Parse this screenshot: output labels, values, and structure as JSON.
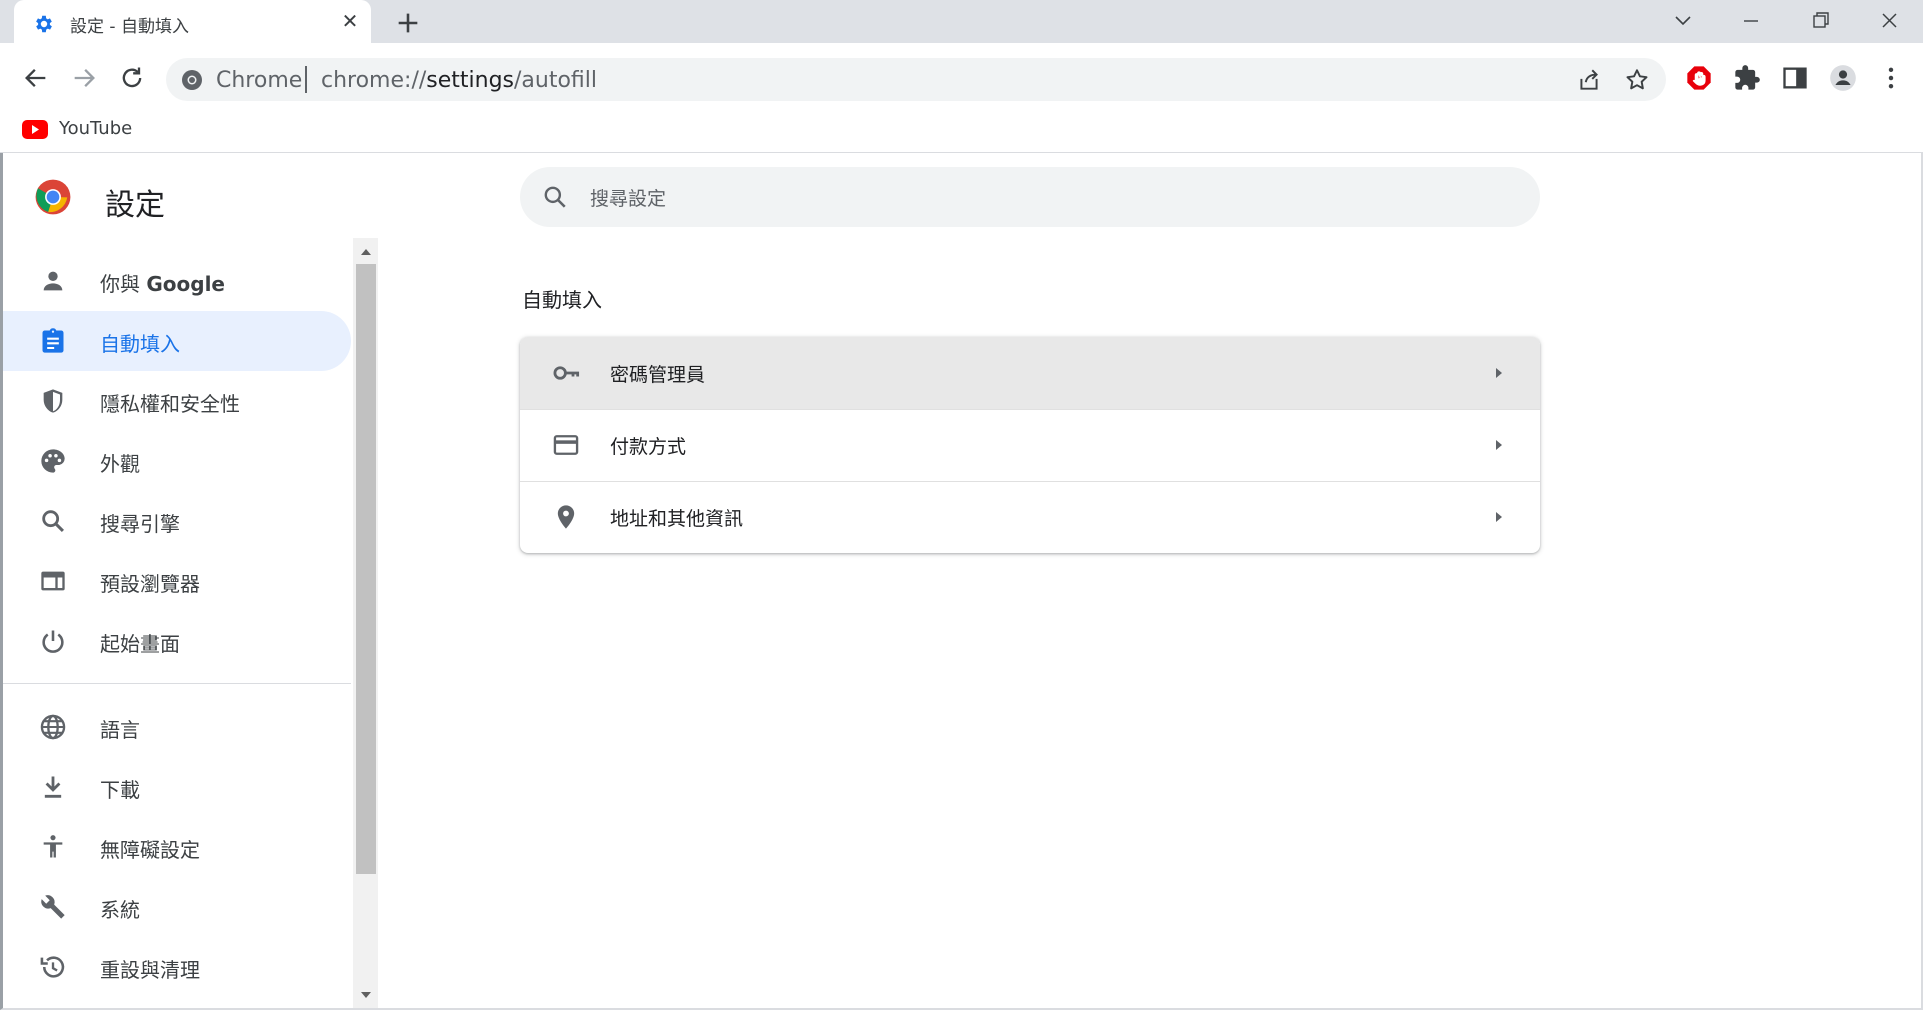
{
  "tab": {
    "title": "設定 - 自動填入",
    "close": "✕",
    "favicon": "gear-icon"
  },
  "window": {
    "minimize": "minimize-icon",
    "restore": "restore-icon",
    "close": "close-icon",
    "tab_search": "chevron-down-icon"
  },
  "toolbar": {
    "site_label": "Chrome",
    "url_prefix": "chrome://",
    "url_path": "settings",
    "url_suffix": "/autofill"
  },
  "bookmarks": [
    {
      "label": "YouTube",
      "icon": "youtube-icon"
    }
  ],
  "settings": {
    "title": "設定",
    "search_placeholder": "搜尋設定"
  },
  "sidebar": {
    "items": [
      {
        "label_prefix": "你與 ",
        "label_bold": "Google",
        "icon": "person-icon",
        "active": false
      },
      {
        "label": "自動填入",
        "icon": "autofill-clipboard-icon",
        "active": true
      },
      {
        "label": "隱私權和安全性",
        "icon": "shield-icon",
        "active": false
      },
      {
        "label": "外觀",
        "icon": "palette-icon",
        "active": false
      },
      {
        "label": "搜尋引擎",
        "icon": "search-icon",
        "active": false
      },
      {
        "label": "預設瀏覽器",
        "icon": "browser-window-icon",
        "active": false
      },
      {
        "label": "起始畫面",
        "icon": "power-icon",
        "active": false
      },
      {
        "label": "語言",
        "icon": "globe-icon",
        "active": false
      },
      {
        "label": "下載",
        "icon": "download-icon",
        "active": false
      },
      {
        "label": "無障礙設定",
        "icon": "accessibility-icon",
        "active": false
      },
      {
        "label": "系統",
        "icon": "wrench-icon",
        "active": false
      },
      {
        "label": "重設與清理",
        "icon": "history-icon",
        "active": false
      }
    ]
  },
  "main": {
    "section_title": "自動填入",
    "rows": [
      {
        "label": "密碼管理員",
        "icon": "key-icon"
      },
      {
        "label": "付款方式",
        "icon": "credit-card-icon"
      },
      {
        "label": "地址和其他資訊",
        "icon": "location-pin-icon"
      }
    ]
  },
  "colors": {
    "accent": "#1a73e8",
    "active_bg": "#e8f0fe",
    "tabstrip": "#dee1e6",
    "omnibox": "#f1f3f4"
  }
}
